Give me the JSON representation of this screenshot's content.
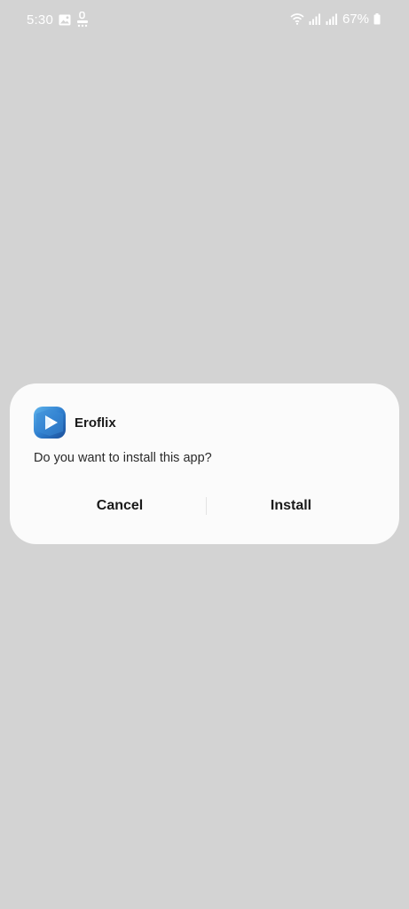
{
  "status_bar": {
    "time": "5:30",
    "battery_percent": "67%",
    "left_icons": [
      "gallery-icon",
      "usb-debug-icon"
    ],
    "right_icons": [
      "wifi-icon",
      "signal-icon",
      "signal-icon",
      "battery-icon"
    ]
  },
  "dialog": {
    "app_name": "Eroflix",
    "app_icon": "play-icon",
    "question": "Do you want to install this app?",
    "cancel_label": "Cancel",
    "install_label": "Install"
  },
  "colors": {
    "background": "#d3d3d3",
    "dialog": "#fbfbfb",
    "app_icon_blue": "#2f7fcf"
  }
}
